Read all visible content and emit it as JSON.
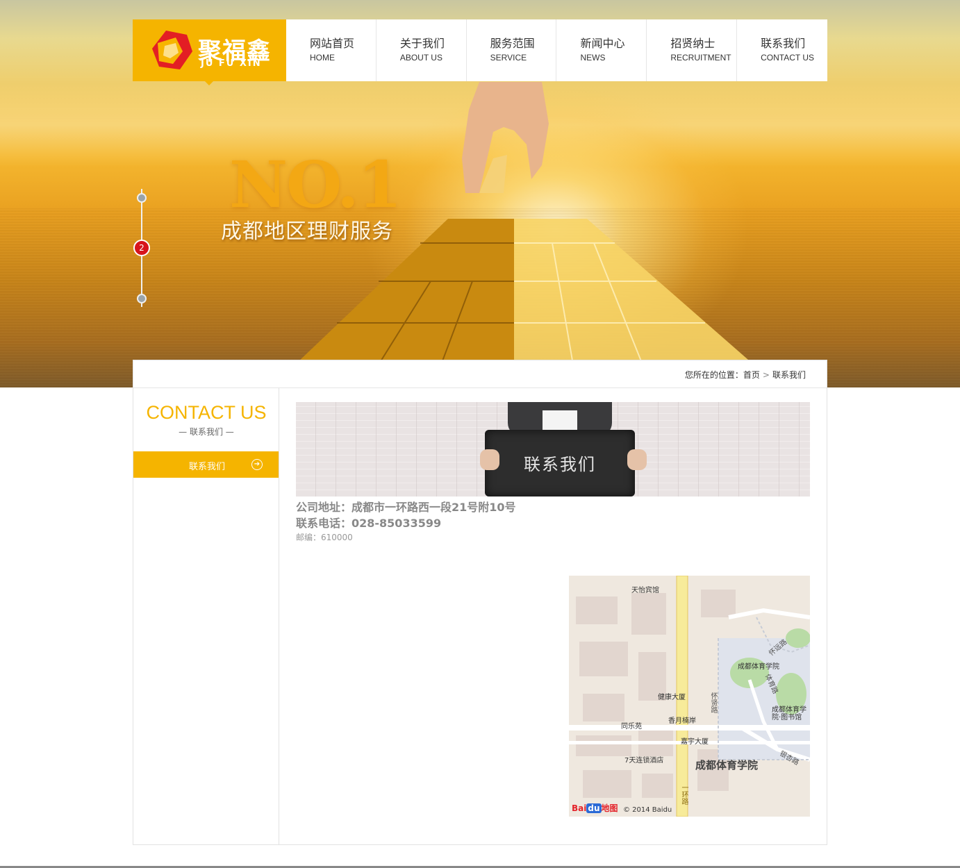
{
  "brand": {
    "name_cn": "聚福鑫",
    "name_en": "JU FU XIN",
    "color": "#f5b400"
  },
  "nav": [
    {
      "cn": "网站首页",
      "en": "HOME"
    },
    {
      "cn": "关于我们",
      "en": "ABOUT US"
    },
    {
      "cn": "服务范围",
      "en": "SERVICE"
    },
    {
      "cn": "新闻中心",
      "en": "NEWS"
    },
    {
      "cn": "招贤纳士",
      "en": "RECRUITMENT"
    },
    {
      "cn": "联系我们",
      "en": "CONTACT US"
    }
  ],
  "banner": {
    "headline": "NO.1",
    "slogan": "成都地区理财服务",
    "active_slide": "2"
  },
  "breadcrumb": {
    "prefix": "您所在的位置：",
    "home": "首页",
    "sep": ">",
    "current": "联系我们"
  },
  "sidebar": {
    "title": "CONTACT US",
    "subtitle": "— 联系我们 —",
    "items": [
      {
        "label": "联系我们"
      }
    ]
  },
  "contact": {
    "photo_caption": "联系我们",
    "address": "公司地址：成都市一环路西一段21号附10号",
    "phone": "联系电话：028-85033599",
    "zip": "邮编：610000"
  },
  "map": {
    "labels": [
      "天怡宾馆",
      "怀远路",
      "成都体育学院",
      "健康大厦",
      "怀贤路",
      "香月楠岸",
      "同乐苑",
      "嘉宇大厦",
      "7天连锁酒店",
      "成都体育学院·图书馆",
      "银杏路",
      "一环路",
      "体育路"
    ],
    "big_label": "成都体育学院",
    "brand_left": "Bai",
    "brand_du": "du",
    "brand_right": "地图",
    "copyright": "© 2014 Baidu"
  }
}
